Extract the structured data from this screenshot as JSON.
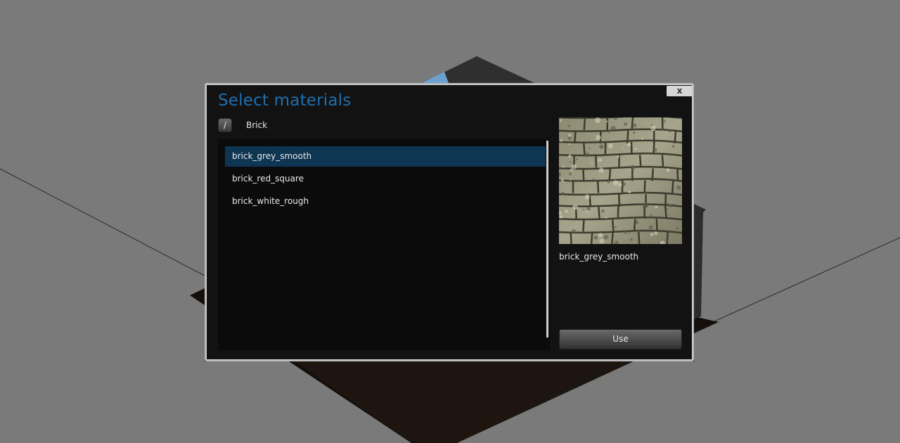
{
  "dialog": {
    "title": "Select materials",
    "close_label": "x",
    "up_label": "/",
    "breadcrumb": "Brick"
  },
  "materials": [
    {
      "name": "brick_grey_smooth",
      "selected": true
    },
    {
      "name": "brick_red_square",
      "selected": false
    },
    {
      "name": "brick_white_rough",
      "selected": false
    }
  ],
  "preview": {
    "name": "brick_grey_smooth",
    "texture": "stone-brick-texture"
  },
  "actions": {
    "use_label": "Use"
  },
  "colors": {
    "title": "#1f6fae",
    "selected_row": "#0e3552",
    "dialog_bg": "#121212",
    "viewport_bg": "#7a7a7a"
  }
}
